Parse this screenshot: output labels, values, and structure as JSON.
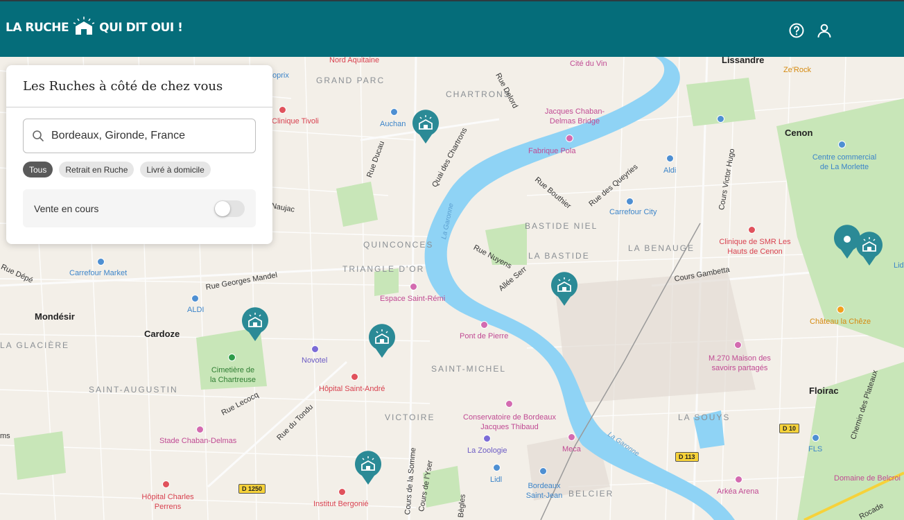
{
  "header": {
    "logo_left": "LA RUCHE",
    "logo_right": "QUI DIT OUI !",
    "help_icon": "help-circle-icon",
    "user_icon": "user-icon"
  },
  "panel": {
    "title": "Les Ruches à côté de chez vous",
    "search_value": "Bordeaux, Gironde, France",
    "search_icon": "search-icon",
    "chips": [
      {
        "label": "Tous",
        "active": true
      },
      {
        "label": "Retrait en Ruche",
        "active": false
      },
      {
        "label": "Livré à domicile",
        "active": false
      }
    ],
    "toggle_label": "Vente en cours",
    "toggle_on": false
  },
  "colors": {
    "brand": "#056d7a",
    "water": "#8fd3f5",
    "park": "#c8e6b8",
    "pin": "#2b8a96"
  },
  "map": {
    "districts": [
      "GRAND PARC",
      "CHARTRONS",
      "BASTIDE NIEL",
      "LA BASTIDE",
      "LA BENAUGE",
      "QUINCONCES",
      "TRIANGLE D'OR",
      "SAINT-MICHEL",
      "VICTOIRE",
      "SAINT-AUGUSTIN",
      "LA GLACIÈRE",
      "LA SOUYS",
      "BELCIER"
    ],
    "cities": [
      "Lissandre",
      "Cenon",
      "Mondésir",
      "Cardoze",
      "Floirac"
    ],
    "streets": [
      "Rue Delord",
      "Rue Ducau",
      "Quai des Chartrons",
      "Rue Bouthier",
      "Rue des Queyries",
      "Cours Victor Hugo",
      "Rue Nuyens",
      "Allée Serr",
      "Cours Gambetta",
      "Rue Georges Mandel",
      "Rue Dépé",
      "Naujac",
      "Rue Lecocq",
      "Rue du Tondu",
      "Cours de la Somme",
      "Cours de l'Yser",
      "Chemin des Plateaux",
      "Rocade",
      "Bègles"
    ],
    "pois": [
      "Nord Aquitaine",
      "Cité du Vin",
      "Ze'Rock",
      "Auchan",
      "Jacques Chaban-Delmas Bridge",
      "Fabrique Pola",
      "Aldi",
      "Centre commercial de La Morlette",
      "Carrefour City",
      "Clinique de SMR Les Hauts de Cenon",
      "Carrefour Market",
      "ALDI",
      "Espace Saint-Rémi",
      "Pont de Pierre",
      "Château la Chêze",
      "Cimetière de la Chartreuse",
      "Novotel",
      "Hôpital Saint-André",
      "M.270 Maison des savoirs partagés",
      "Conservatoire de Bordeaux Jacques Thibaud",
      "Stade Chaban-Delmas",
      "La Zoologie",
      "Meca",
      "FLS",
      "Lidl",
      "Bordeaux Saint-Jean",
      "Domaine de Belcroi",
      "Hôpital Charles Perrens",
      "Institut Bergonié",
      "Arkéa Arena",
      "Clinique Tivoli",
      "oprix",
      "Lid",
      "ms"
    ],
    "rivers": [
      "La Garonne",
      "La Garonne"
    ],
    "road_tags": [
      "D 10",
      "D 113",
      "D 1250"
    ],
    "marker_count": 7
  }
}
